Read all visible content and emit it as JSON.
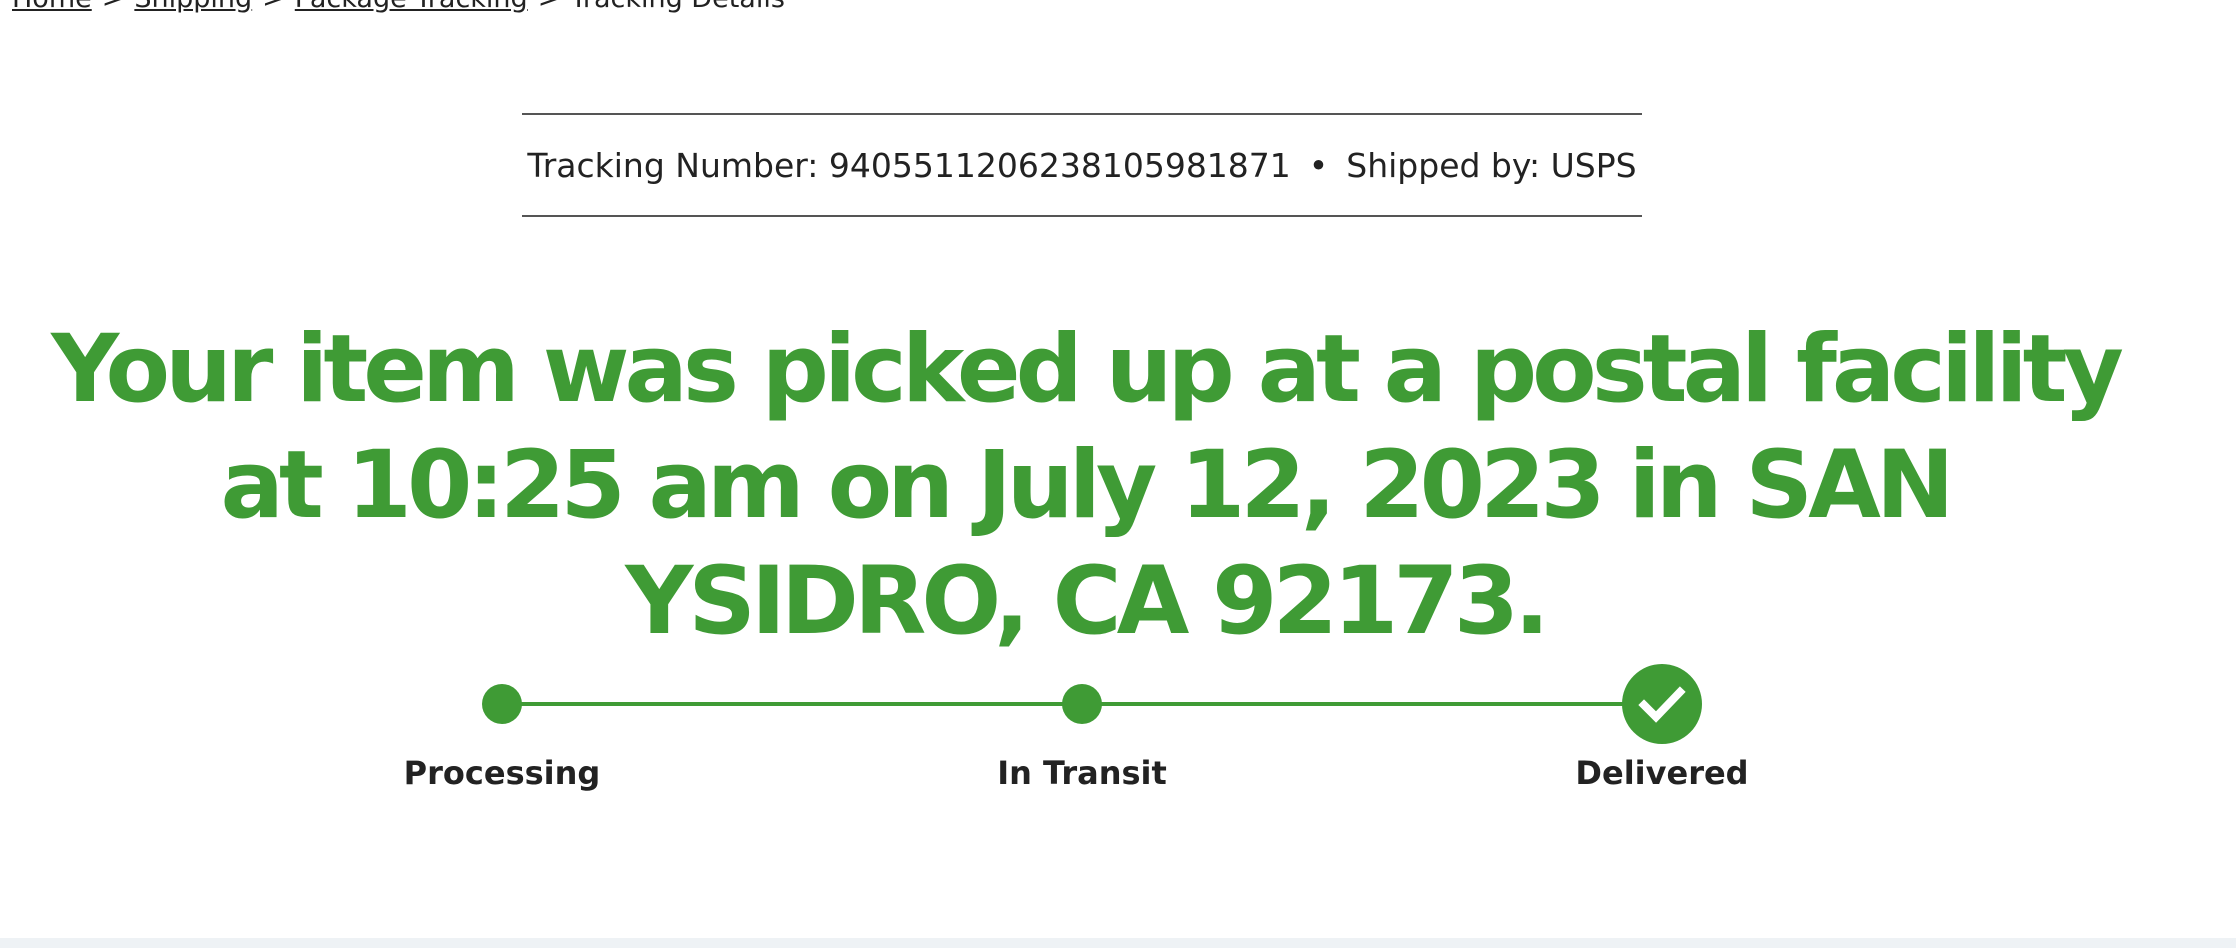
{
  "breadcrumb": {
    "items": [
      "Home",
      "Shipping",
      "Package Tracking"
    ],
    "current": "Tracking Details",
    "separator": ">"
  },
  "tracking": {
    "number_label": "Tracking Number:",
    "number": "9405511206238105981871",
    "bullet": "•",
    "carrier_label": "Shipped by:",
    "carrier": "USPS"
  },
  "status": {
    "headline": "Your item was picked up at a postal facility at 10:25 am on July 12, 2023 in SAN YSIDRO, CA 92173."
  },
  "progress": {
    "steps": [
      "Processing",
      "In Transit",
      "Delivered"
    ],
    "completed_steps": 3,
    "accent_color": "#3f9b35",
    "final_icon": "check-icon"
  }
}
